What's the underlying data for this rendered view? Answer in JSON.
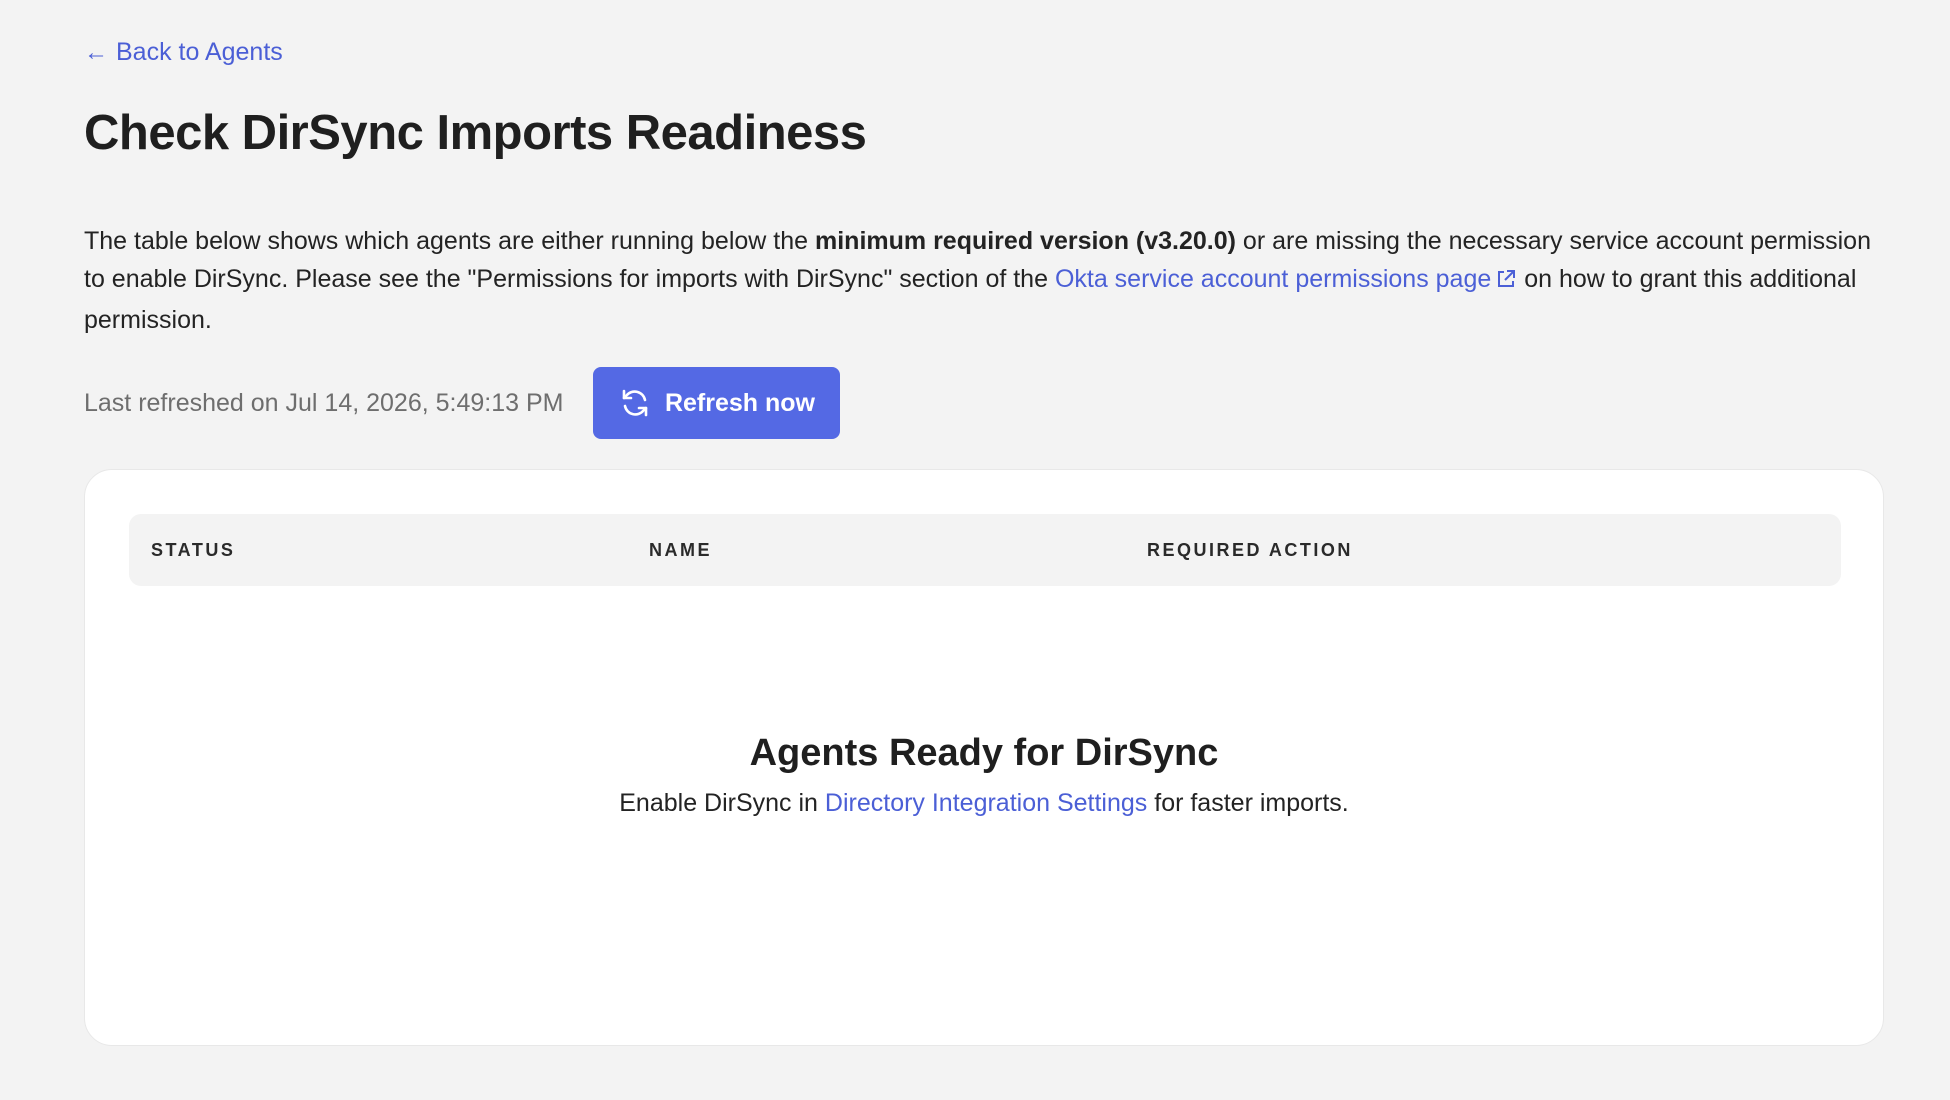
{
  "back_link": {
    "arrow": "←",
    "label": "Back to Agents"
  },
  "page_title": "Check DirSync Imports Readiness",
  "description": {
    "intro": "The table below shows which agents are either running below the ",
    "bold_version": "minimum required version (v3.20.0)",
    "middle": " or are missing the necessary service account permission to enable DirSync. Please see the \"Permissions for imports with DirSync\" section of the ",
    "link_text": "Okta service account permissions page",
    "link_icon": "external-link-icon",
    "outro": " on how to grant this additional permission."
  },
  "refresh": {
    "last_refreshed": "Last refreshed on Jul 14, 2026, 5:49:13 PM",
    "button_label": "Refresh now",
    "button_icon": "refresh-icon"
  },
  "table": {
    "columns": [
      "STATUS",
      "NAME",
      "REQUIRED ACTION"
    ],
    "rows": []
  },
  "empty_state": {
    "title": "Agents Ready for DirSync",
    "text_before": "Enable DirSync in ",
    "link_text": "Directory Integration Settings",
    "text_after": " for faster imports."
  },
  "colors": {
    "accent": "#5469e4",
    "link": "#4b5fd6",
    "background": "#f3f3f3",
    "card": "#ffffff"
  }
}
